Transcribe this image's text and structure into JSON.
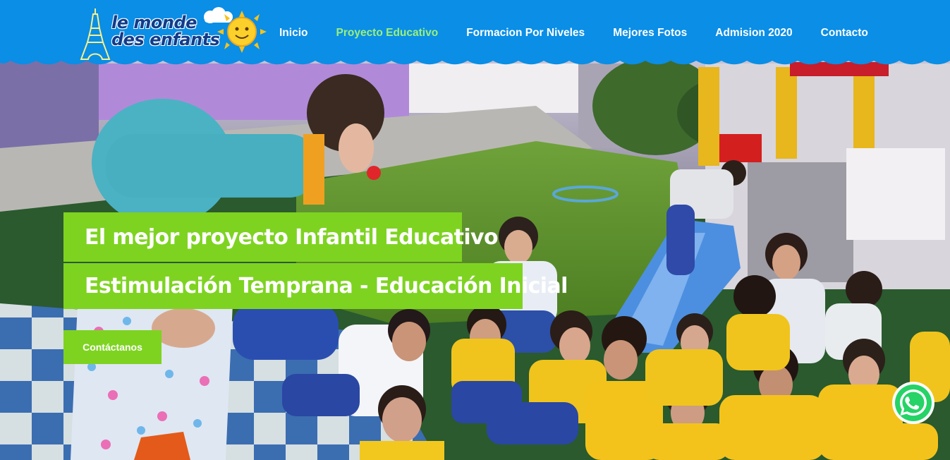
{
  "header": {
    "logo": {
      "line1": "le monde",
      "line2": "des enfants"
    },
    "nav": [
      {
        "label": "Inicio"
      },
      {
        "label": "Proyecto Educativo",
        "active": true
      },
      {
        "label": "Formacion Por Niveles"
      },
      {
        "label": "Mejores Fotos"
      },
      {
        "label": "Admision 2020"
      },
      {
        "label": "Contacto"
      }
    ]
  },
  "hero": {
    "headline1": "El mejor proyecto Infantil Educativo",
    "headline2": "Estimulación Temprana - Educación Inicial",
    "cta_label": "Contáctanos"
  },
  "colors": {
    "header_blue": "#0a8ee6",
    "nav_active": "#9cf07a",
    "accent_green": "#7ed321",
    "whatsapp_green": "#25d366"
  },
  "icons": {
    "logo": "eiffel-tower-sun-cloud-logo",
    "whatsapp": "whatsapp-icon"
  }
}
